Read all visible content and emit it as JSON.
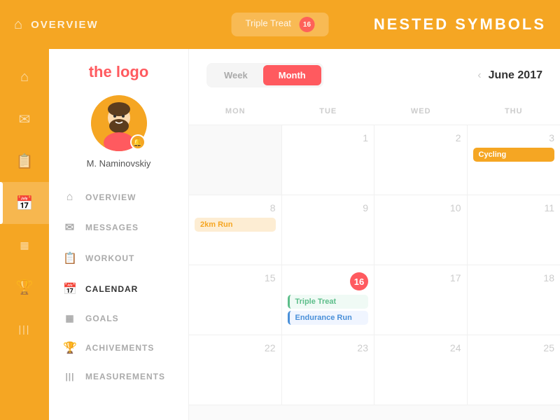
{
  "topBar": {
    "title": "OVERVIEW",
    "notificationCount": "16",
    "centerText": "Triple Treat",
    "rightTitle": "NESTED SYMBOLS"
  },
  "logo": {
    "text": "the logo"
  },
  "user": {
    "name": "M. Naminovskiy"
  },
  "sidebar": {
    "items": [
      {
        "id": "overview",
        "label": "OVERVIEW",
        "icon": "⌂"
      },
      {
        "id": "messages",
        "label": "MESSAGES",
        "icon": "✉"
      },
      {
        "id": "workout",
        "label": "WORKOUT",
        "icon": "📋"
      },
      {
        "id": "calendar",
        "label": "CALENDAR",
        "icon": "📅",
        "active": true
      },
      {
        "id": "goals",
        "label": "GOALS",
        "icon": "▦"
      },
      {
        "id": "achievements",
        "label": "ACHIVEMENTS",
        "icon": "🏆"
      },
      {
        "id": "measurements",
        "label": "MEASUREMENTS",
        "icon": "|||"
      }
    ]
  },
  "iconSidebar": {
    "items": [
      {
        "id": "home",
        "icon": "⌂"
      },
      {
        "id": "mail",
        "icon": "✉"
      },
      {
        "id": "clipboard",
        "icon": "📋"
      },
      {
        "id": "calendar",
        "icon": "📅",
        "active": true
      },
      {
        "id": "chart",
        "icon": "▦"
      },
      {
        "id": "trophy",
        "icon": "🏆"
      },
      {
        "id": "bars",
        "icon": "|||"
      }
    ]
  },
  "calendar": {
    "viewToggle": {
      "week": "Week",
      "month": "Month"
    },
    "currentMonth": "June 2017",
    "headers": [
      "MON",
      "TUE",
      "WED",
      "THU"
    ],
    "weeks": [
      [
        {
          "date": "",
          "empty": true
        },
        {
          "date": "1"
        },
        {
          "date": "2"
        },
        {
          "date": "3",
          "events": [
            {
              "label": "Cycling",
              "type": "orange"
            }
          ]
        }
      ],
      [
        {
          "date": "8",
          "events": [
            {
              "label": "2km Run",
              "type": "orange-light"
            }
          ]
        },
        {
          "date": "9"
        },
        {
          "date": "10"
        },
        {
          "date": "11"
        }
      ],
      [
        {
          "date": "15"
        },
        {
          "date": "16",
          "today": true,
          "events": [
            {
              "label": "Triple Treat",
              "type": "green-outline"
            },
            {
              "label": "Endurance Run",
              "type": "blue-outline"
            }
          ]
        },
        {
          "date": "17"
        },
        {
          "date": "18"
        }
      ],
      [
        {
          "date": "22"
        },
        {
          "date": "23"
        },
        {
          "date": "24"
        },
        {
          "date": "25"
        }
      ]
    ]
  }
}
